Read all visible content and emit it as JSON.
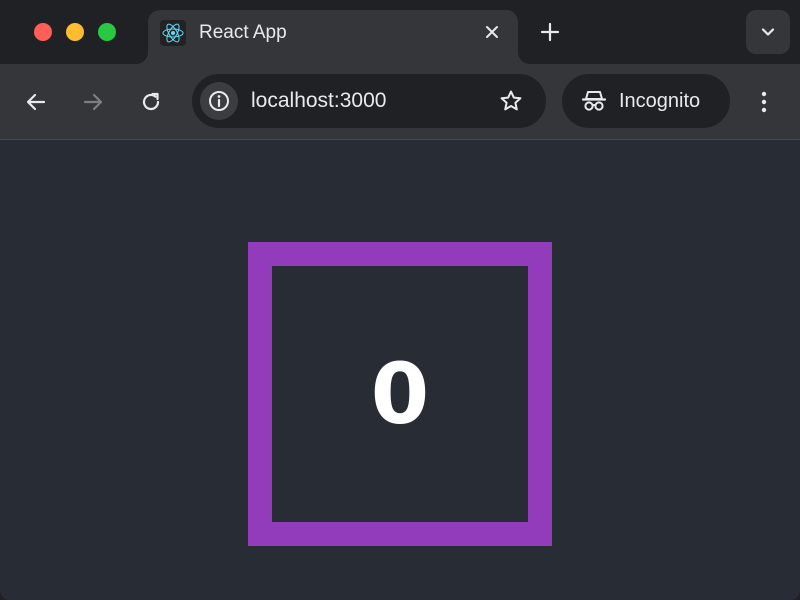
{
  "browser": {
    "tab": {
      "title": "React App",
      "favicon": "react-logo-icon"
    },
    "address_bar": {
      "url": "localhost:3000"
    },
    "profile": {
      "label": "Incognito"
    }
  },
  "page": {
    "counter": {
      "value": "0",
      "border_color": "#923cbc",
      "background_color": "#282c34"
    }
  },
  "icons": {
    "close_window": "close-window-icon",
    "minimize_window": "minimize-window-icon",
    "maximize_window": "maximize-window-icon",
    "tab_close": "close-icon",
    "new_tab": "plus-icon",
    "tab_search": "chevron-down-icon",
    "back": "arrow-left-icon",
    "forward": "arrow-right-icon",
    "reload": "reload-icon",
    "site_info": "info-icon",
    "bookmark": "star-icon",
    "incognito": "incognito-icon",
    "menu": "more-vertical-icon"
  }
}
